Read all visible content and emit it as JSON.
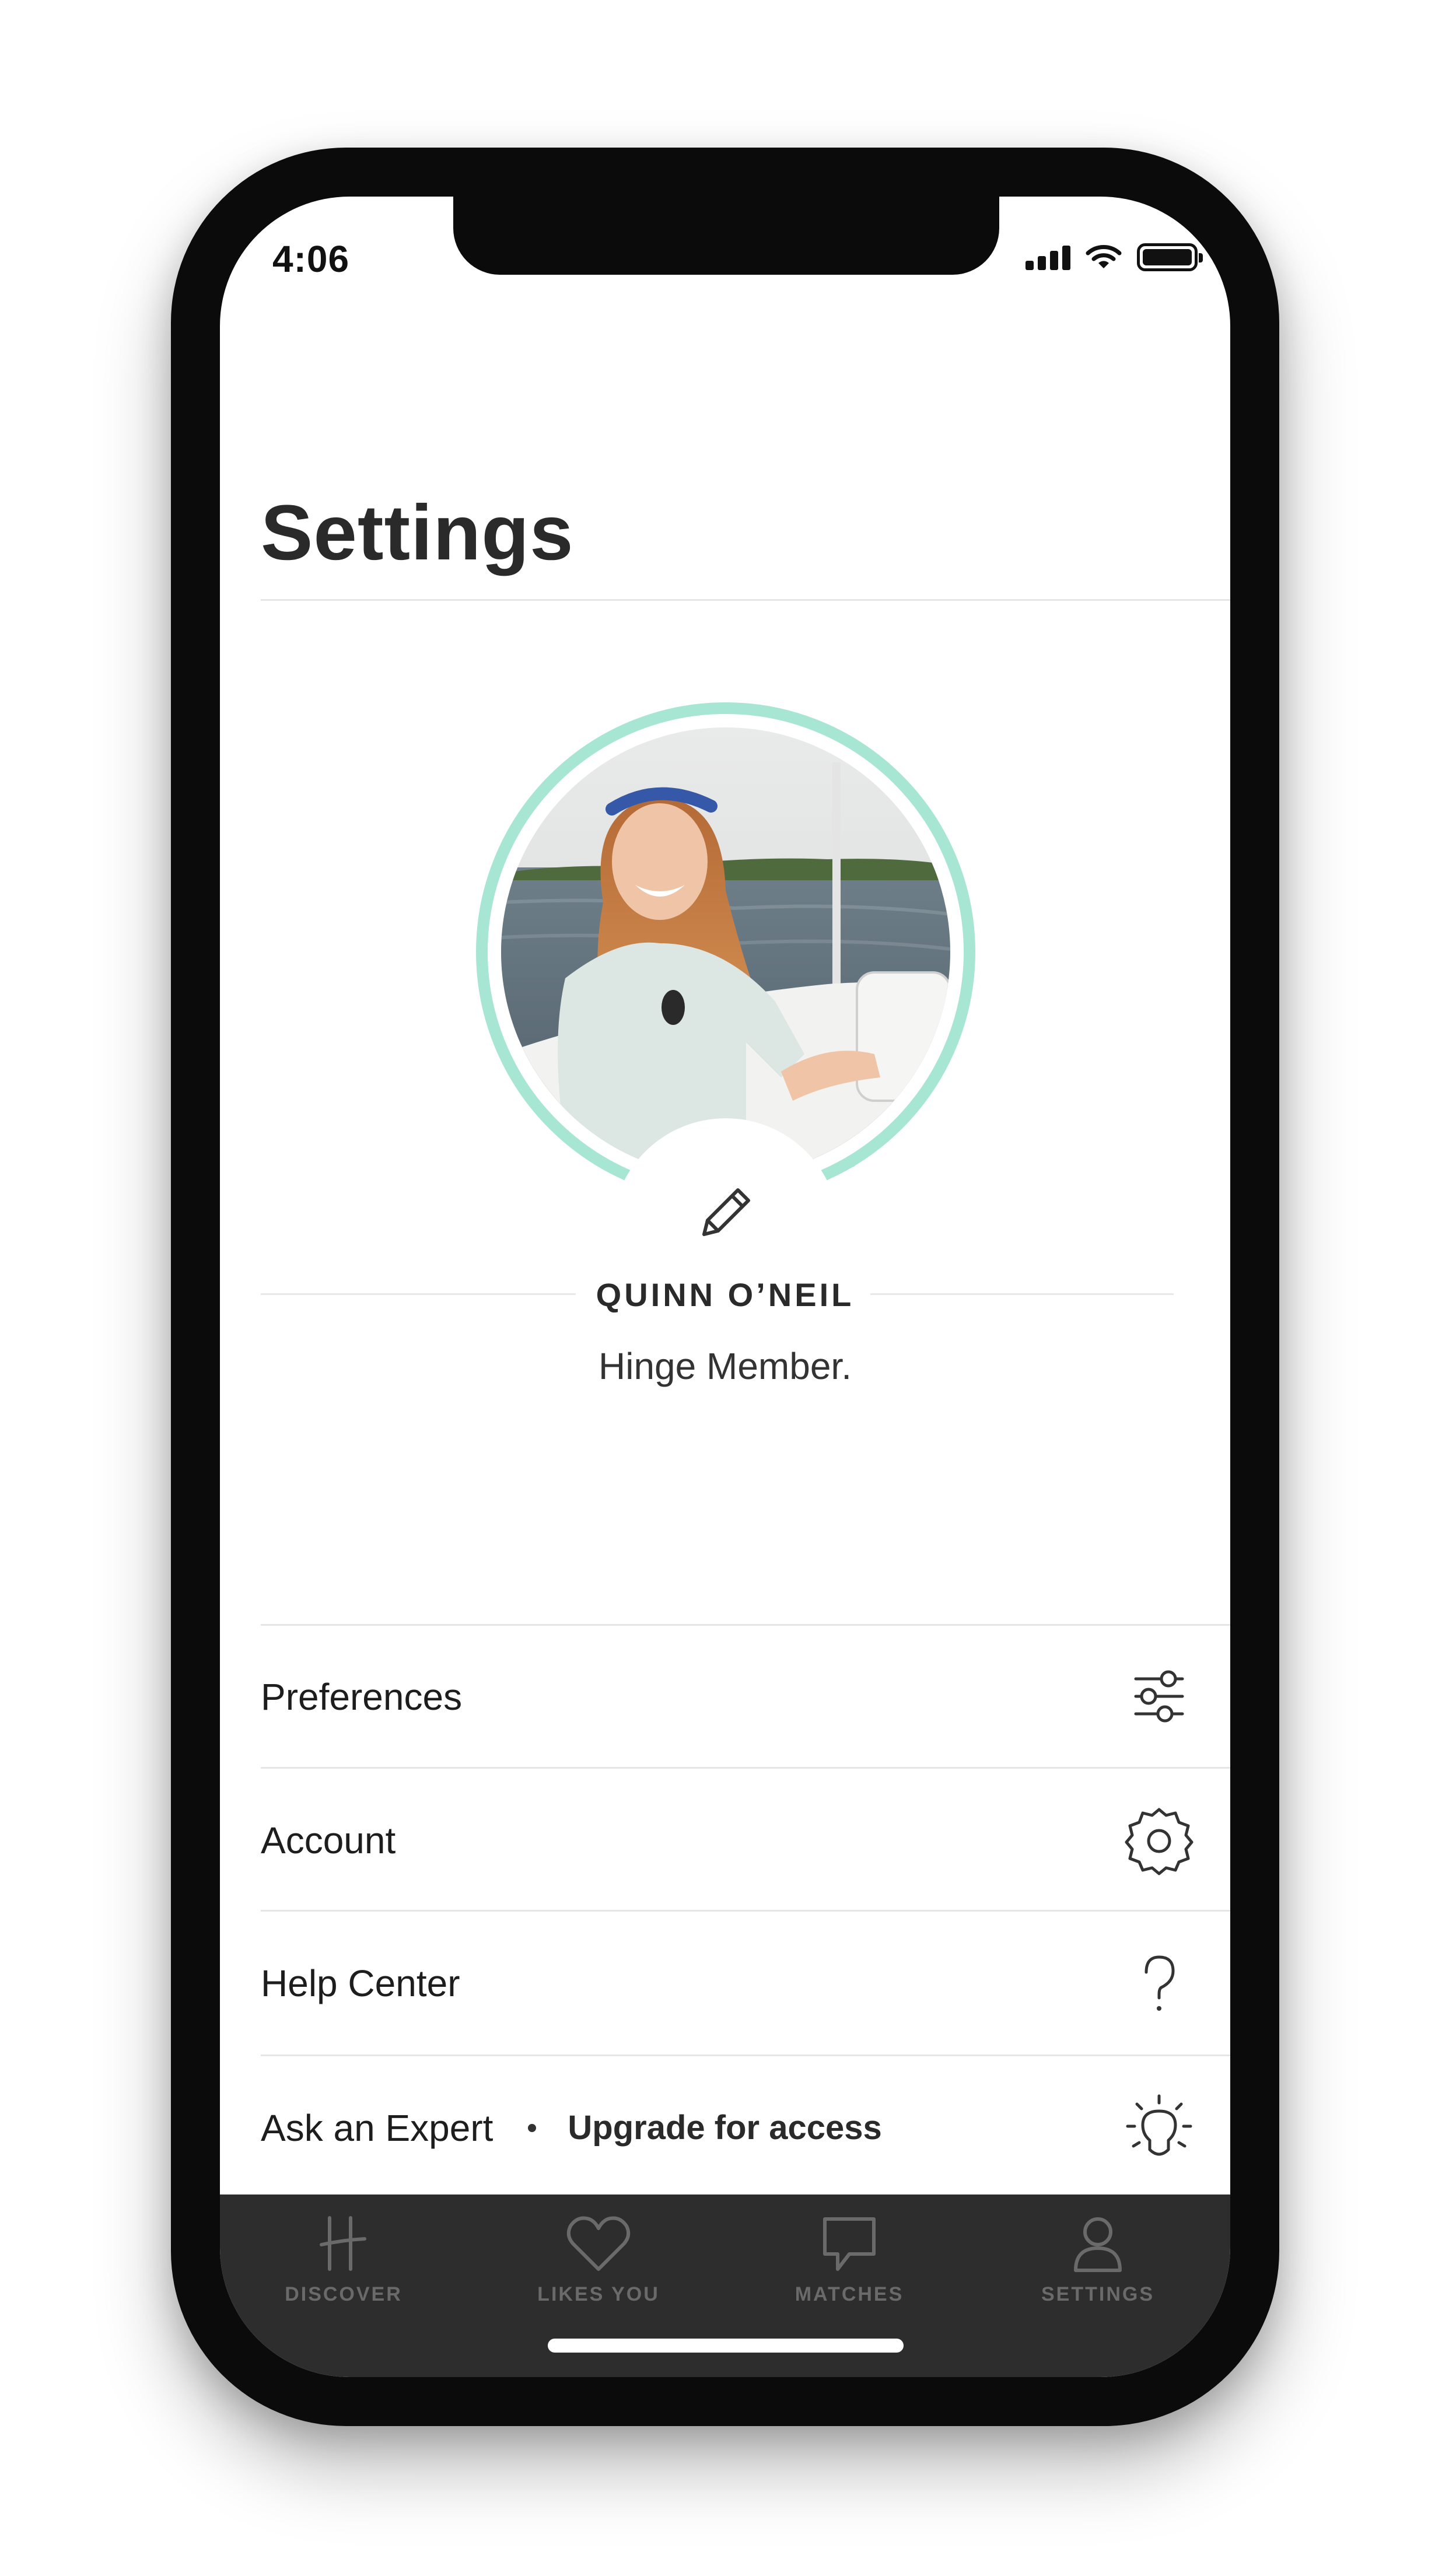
{
  "status_bar": {
    "time": "4:06"
  },
  "header": {
    "title": "Settings"
  },
  "profile": {
    "name": "QUINN O’NEIL",
    "subtitle": "Hinge Member.",
    "ring_color": "#a7e6d2"
  },
  "menu": {
    "items": [
      {
        "label": "Preferences",
        "icon": "sliders-icon"
      },
      {
        "label": "Account",
        "icon": "gear-icon"
      },
      {
        "label": "Help Center",
        "icon": "question-icon"
      },
      {
        "label": "Ask an Expert",
        "badge": "Upgrade for access",
        "icon": "lightbulb-icon"
      }
    ]
  },
  "tabbar": {
    "tabs": [
      {
        "label": "DISCOVER",
        "icon": "hinge-logo-icon"
      },
      {
        "label": "LIKES YOU",
        "icon": "heart-icon"
      },
      {
        "label": "MATCHES",
        "icon": "chat-bubble-icon"
      },
      {
        "label": "SETTINGS",
        "icon": "person-icon"
      }
    ],
    "background": "#2d2d2d",
    "inactive_color": "#6a6a6a"
  }
}
